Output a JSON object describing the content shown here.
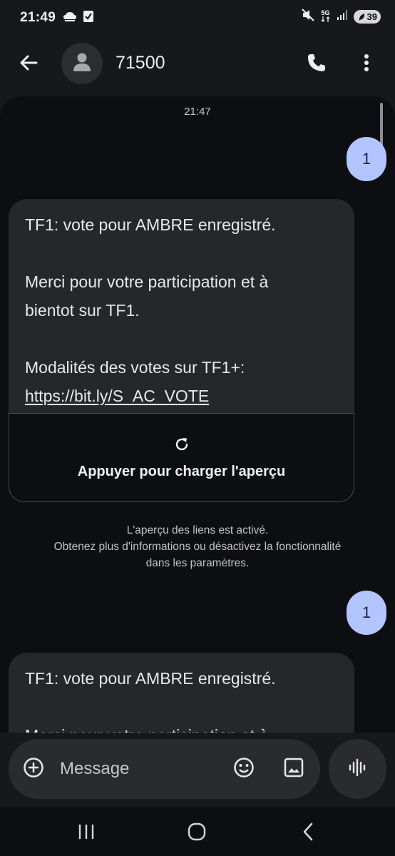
{
  "status_bar": {
    "time": "21:49",
    "network": "5G",
    "battery": "39",
    "left_icons": [
      "cloud-icon",
      "task-check-icon"
    ],
    "right_icons": [
      "mute-icon",
      "network-5g-icon",
      "signal-icon",
      "battery-icon"
    ]
  },
  "app_bar": {
    "contact_name": "71500",
    "icons": [
      "back-arrow-icon",
      "person-icon",
      "phone-icon",
      "more-vert-icon"
    ]
  },
  "conversation": {
    "timestamp": "21:47",
    "outgoing": [
      {
        "text": "1"
      },
      {
        "text": "1"
      }
    ],
    "incoming": [
      {
        "line1": "TF1: vote pour AMBRE enregistré.",
        "line2": "Merci pour votre participation et à",
        "line3": "bientot sur TF1.",
        "line4": "Modalités des votes sur TF1+:",
        "link": "https://bit.ly/S_AC_VOTE"
      },
      {
        "line1": "TF1: vote pour AMBRE enregistré.",
        "line2": "Merci pour votre participation et à"
      }
    ],
    "link_preview": {
      "label": "Appuyer pour charger l'aperçu",
      "icon": "refresh-icon"
    },
    "info_note": {
      "line1": "L'aperçu des liens est activé.",
      "line2": "Obtenez plus d'informations ou désactivez la fonctionnalité",
      "line3": "dans les paramètres."
    }
  },
  "composer": {
    "placeholder": "Message",
    "value": "",
    "icons": [
      "add-circle-icon",
      "emoji-icon",
      "gallery-icon",
      "voice-waveform-icon"
    ]
  },
  "nav_bar": {
    "icons": [
      "recent-apps-icon",
      "home-icon",
      "back-nav-icon"
    ]
  },
  "colors": {
    "background": "#17181c",
    "conversation_background": "#0d0e11",
    "outgoing_bubble": "#b3c5ff",
    "incoming_bubble": "#26272b",
    "composer": "#2a2b2f"
  }
}
